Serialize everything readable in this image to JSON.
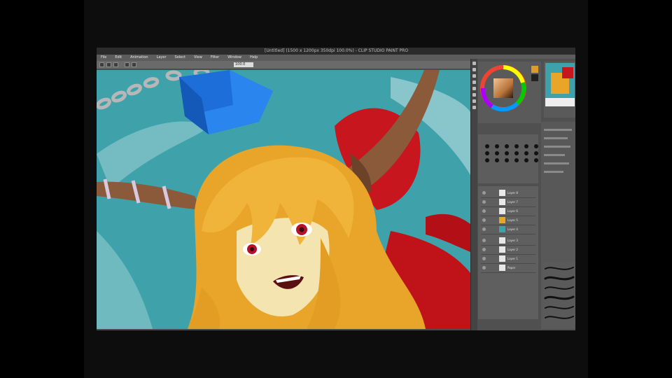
{
  "app": {
    "title": "[Untitled] (1500 x 1200px 350dpi 100.0%) - CLIP STUDIO PAINT PRO",
    "menus": [
      "File",
      "Edit",
      "Animation",
      "Layer",
      "Select",
      "View",
      "Filter",
      "Window",
      "Help"
    ],
    "toolbar_field_value": "100.0"
  },
  "colors": {
    "sky": "#3fa2ab",
    "hair": "#e8a52a",
    "horn": "#8a5a3a",
    "bow": "#c8161e",
    "cube": "#1f6fd6",
    "ui_dark": "#4b4b4b"
  },
  "panels": {
    "layers": [
      {
        "name": "Layer 8"
      },
      {
        "name": "Layer 7"
      },
      {
        "name": "Layer 6"
      },
      {
        "name": "Layer 5"
      },
      {
        "name": "Layer 4"
      },
      {
        "name": "Layer 3"
      },
      {
        "name": "Layer 2"
      },
      {
        "name": "Layer 1"
      },
      {
        "name": "Paper"
      }
    ]
  },
  "icons": [
    "color-wheel-icon",
    "navigator-thumbnail-icon",
    "brush-icon",
    "eye-icon"
  ]
}
